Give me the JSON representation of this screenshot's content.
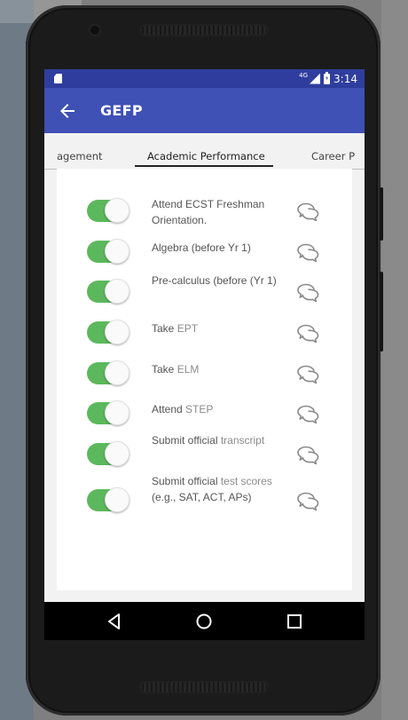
{
  "status_bar": {
    "network": "4G",
    "time": "3:14"
  },
  "app_bar": {
    "title": "GEFP",
    "back_icon": "arrow-left-icon"
  },
  "tabs": [
    {
      "label": "agement",
      "active": false
    },
    {
      "label": "Academic Performance",
      "active": true
    },
    {
      "label": "Career P",
      "active": false
    }
  ],
  "tasks": [
    {
      "parts": [
        {
          "text": "Attend ECST Freshman Orientation.",
          "dim": false
        }
      ],
      "completed": true
    },
    {
      "parts": [
        {
          "text": "Algebra (before Yr 1)",
          "dim": false
        }
      ],
      "completed": true
    },
    {
      "parts": [
        {
          "text": "Pre-calculus (before (Yr 1)",
          "dim": false
        }
      ],
      "completed": true
    },
    {
      "parts": [
        {
          "text": "Take ",
          "dim": false
        },
        {
          "text": "EPT",
          "dim": true
        }
      ],
      "completed": true
    },
    {
      "parts": [
        {
          "text": "Take ",
          "dim": false
        },
        {
          "text": "ELM",
          "dim": true
        }
      ],
      "completed": true
    },
    {
      "parts": [
        {
          "text": "Attend ",
          "dim": false
        },
        {
          "text": "STEP",
          "dim": true
        }
      ],
      "completed": true
    },
    {
      "parts": [
        {
          "text": "Submit official ",
          "dim": false
        },
        {
          "text": "transcript",
          "dim": true
        }
      ],
      "completed": true
    },
    {
      "parts": [
        {
          "text": "Submit official ",
          "dim": false
        },
        {
          "text": "test scores",
          "dim": true
        },
        {
          "text": " (e.g., SAT, ACT, APs)",
          "dim": false
        }
      ],
      "completed": true
    }
  ],
  "colors": {
    "status_bar": "#2f3e9e",
    "app_bar": "#3f51b5",
    "toggle_on": "#5cb85c"
  },
  "icons": {
    "task_action": "comments-icon",
    "nav_back": "nav-back-icon",
    "nav_home": "nav-home-icon",
    "nav_recents": "nav-recents-icon"
  }
}
